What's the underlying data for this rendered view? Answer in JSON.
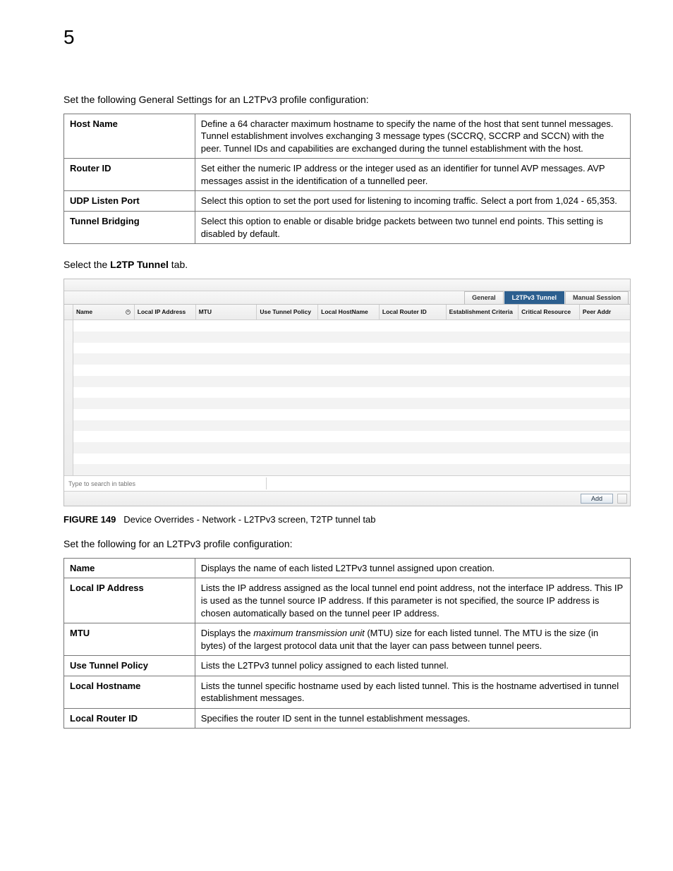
{
  "chapterNumber": "5",
  "intro1": "Set the following General Settings for an L2TPv3 profile configuration:",
  "table1": [
    {
      "label": "Host Name",
      "desc": "Define a 64 character maximum hostname to specify the name of the host that sent tunnel messages. Tunnel establishment involves exchanging 3 message types (SCCRQ, SCCRP and SCCN) with the peer. Tunnel IDs and capabilities are exchanged during the tunnel establishment with the host."
    },
    {
      "label": "Router ID",
      "desc": "Set either the numeric IP address or the integer used as an identifier for tunnel AVP messages. AVP messages assist in the identification of a tunnelled peer."
    },
    {
      "label": "UDP Listen Port",
      "desc": "Select this option to set the port used for listening to incoming traffic. Select a port from 1,024 - 65,353."
    },
    {
      "label": "Tunnel Bridging",
      "desc": "Select this option to enable or disable bridge packets between two tunnel end points. This setting is disabled by default."
    }
  ],
  "step_select_pre": "Select the ",
  "step_select_bold": "L2TP Tunnel",
  "step_select_post": " tab.",
  "gridTabs": {
    "general": "General",
    "l2tpv3": "L2TPv3 Tunnel",
    "manual": "Manual Session"
  },
  "gridHeaders": {
    "name": "Name",
    "localIp": "Local IP Address",
    "mtu": "MTU",
    "useTunnel": "Use Tunnel Policy",
    "localHost": "Local HostName",
    "localRouter": "Local Router ID",
    "establish": "Establishment Criteria",
    "critical": "Critical Resource",
    "peer": "Peer Addr"
  },
  "gridSearchPlaceholder": "Type to search in tables",
  "gridAddButton": "Add",
  "figure_prefix": "FIGURE 149",
  "figure_text": "Device Overrides - Network - L2TPv3 screen, T2TP tunnel tab",
  "intro2": "Set the following for an L2TPv3 profile configuration:",
  "table2": [
    {
      "label": "Name",
      "desc": "Displays the name of each listed L2TPv3 tunnel assigned upon creation."
    },
    {
      "label": "Local IP Address",
      "desc": "Lists the IP address assigned as the local tunnel end point address, not the interface IP address. This IP is used as the tunnel source IP address. If this parameter is not specified, the source IP address is chosen automatically based on the tunnel peer IP address."
    },
    {
      "label": "MTU",
      "desc_pre": "Displays the ",
      "desc_italic": "maximum transmission unit",
      "desc_post": " (MTU) size for each listed tunnel. The MTU is the size (in bytes) of the largest protocol data unit that the layer can pass between tunnel peers."
    },
    {
      "label": "Use Tunnel Policy",
      "desc": "Lists the L2TPv3 tunnel policy assigned to each listed tunnel."
    },
    {
      "label": "Local Hostname",
      "desc": "Lists the tunnel specific hostname used by each listed tunnel. This is the hostname advertised in tunnel establishment messages."
    },
    {
      "label": "Local Router ID",
      "desc": "Specifies the router ID sent in the tunnel establishment messages."
    }
  ]
}
